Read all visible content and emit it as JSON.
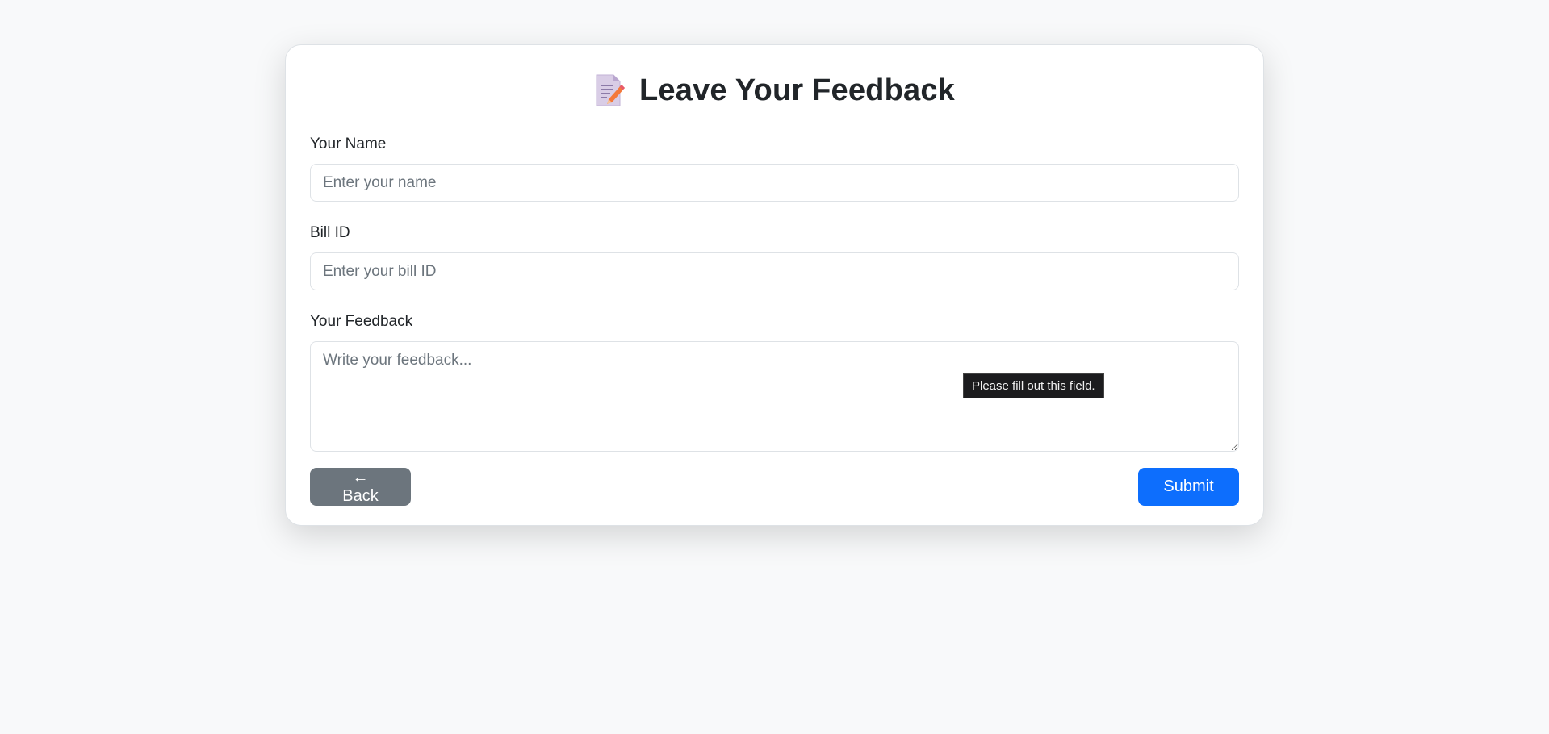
{
  "header": {
    "icon": "memo-icon",
    "title": "Leave Your Feedback"
  },
  "form": {
    "name": {
      "label": "Your Name",
      "value": "",
      "placeholder": "Enter your name"
    },
    "bill_id": {
      "label": "Bill ID",
      "value": "",
      "placeholder": "Enter your bill ID"
    },
    "feedback": {
      "label": "Your Feedback",
      "value": "",
      "placeholder": "Write your feedback..."
    },
    "validation_tooltip": "Please fill out this field."
  },
  "buttons": {
    "back_label": "← Back",
    "submit_label": "Submit"
  },
  "colors": {
    "background": "#f8f9fa",
    "primary": "#0d6efd",
    "secondary": "#6c757d",
    "text": "#212529"
  }
}
